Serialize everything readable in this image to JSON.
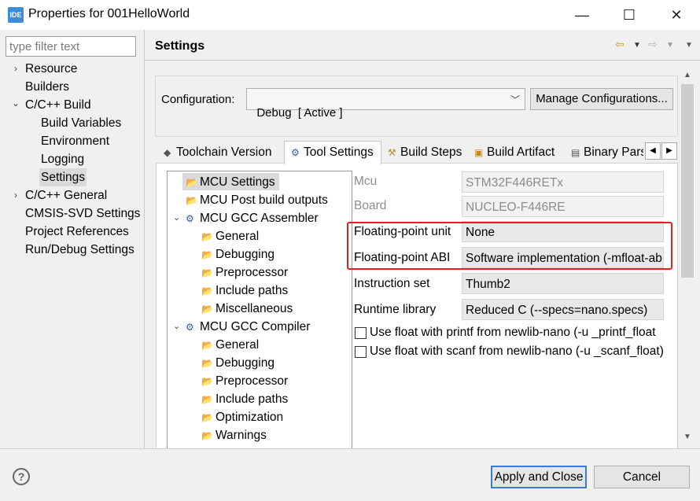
{
  "window": {
    "app_icon_label": "IDE",
    "title": "Properties for 001HelloWorld",
    "minimize": "—",
    "maximize": "☐",
    "close": "✕"
  },
  "filter": {
    "placeholder": "type filter text"
  },
  "nav": {
    "items": [
      {
        "label": "Resource",
        "expander": "›"
      },
      {
        "label": "Builders"
      },
      {
        "label": "C/C++ Build",
        "expander": "⌄"
      },
      {
        "label": "Build Variables"
      },
      {
        "label": "Environment"
      },
      {
        "label": "Logging"
      },
      {
        "label": "Settings",
        "selected": true
      },
      {
        "label": "C/C++ General",
        "expander": "›"
      },
      {
        "label": "CMSIS-SVD Settings"
      },
      {
        "label": "Project References"
      },
      {
        "label": "Run/Debug Settings"
      }
    ]
  },
  "header": {
    "title": "Settings",
    "icons": [
      "back-arrow-icon",
      "dropdown-icon",
      "forward-arrow-icon",
      "dropdown-icon",
      "menu-icon"
    ]
  },
  "configuration": {
    "label": "Configuration:",
    "value": "Debug  [ Active ]",
    "manage_button": "Manage Configurations..."
  },
  "tabs": [
    {
      "label": "Toolchain  Version",
      "icon": "chip-icon"
    },
    {
      "label": "Tool Settings",
      "icon": "gear-icon",
      "active": true
    },
    {
      "label": "Build Steps",
      "icon": "hammer-icon"
    },
    {
      "label": "Build Artifact",
      "icon": "artifact-icon"
    },
    {
      "label": "Binary Pars",
      "icon": "binary-icon"
    }
  ],
  "tool_tree": [
    {
      "label": "MCU Settings",
      "icon": "folder-icon",
      "selected": true
    },
    {
      "label": "MCU Post build outputs",
      "icon": "folder-icon"
    },
    {
      "label": "MCU GCC Assembler",
      "icon": "gear-icon",
      "expander": "⌄"
    },
    {
      "label": "General",
      "icon": "folder-icon"
    },
    {
      "label": "Debugging",
      "icon": "folder-icon"
    },
    {
      "label": "Preprocessor",
      "icon": "folder-icon"
    },
    {
      "label": "Include paths",
      "icon": "folder-icon"
    },
    {
      "label": "Miscellaneous",
      "icon": "folder-icon"
    },
    {
      "label": "MCU GCC Compiler",
      "icon": "gear-icon",
      "expander": "⌄"
    },
    {
      "label": "General",
      "icon": "folder-icon"
    },
    {
      "label": "Debugging",
      "icon": "folder-icon"
    },
    {
      "label": "Preprocessor",
      "icon": "folder-icon"
    },
    {
      "label": "Include paths",
      "icon": "folder-icon"
    },
    {
      "label": "Optimization",
      "icon": "folder-icon"
    },
    {
      "label": "Warnings",
      "icon": "folder-icon"
    }
  ],
  "properties": {
    "mcu": {
      "label": "Mcu",
      "value": "STM32F446RETx"
    },
    "board": {
      "label": "Board",
      "value": "NUCLEO-F446RE"
    },
    "fpu": {
      "label": "Floating-point unit",
      "value": "None"
    },
    "abi": {
      "label": "Floating-point ABI",
      "value": "Software implementation (-mfloat-ab"
    },
    "instruction_set": {
      "label": "Instruction set",
      "value": "Thumb2"
    },
    "runtime": {
      "label": "Runtime library",
      "value": "Reduced C (--specs=nano.specs)"
    },
    "printf_float": {
      "label": "Use float with printf from newlib-nano (-u _printf_float",
      "checked": false
    },
    "scanf_float": {
      "label": "Use float with scanf from newlib-nano (-u _scanf_float)",
      "checked": false
    }
  },
  "footer": {
    "help": "?",
    "apply_close": "Apply and Close",
    "cancel": "Cancel"
  },
  "colors": {
    "highlight": "#e02020",
    "accent": "#3a7bd5"
  }
}
